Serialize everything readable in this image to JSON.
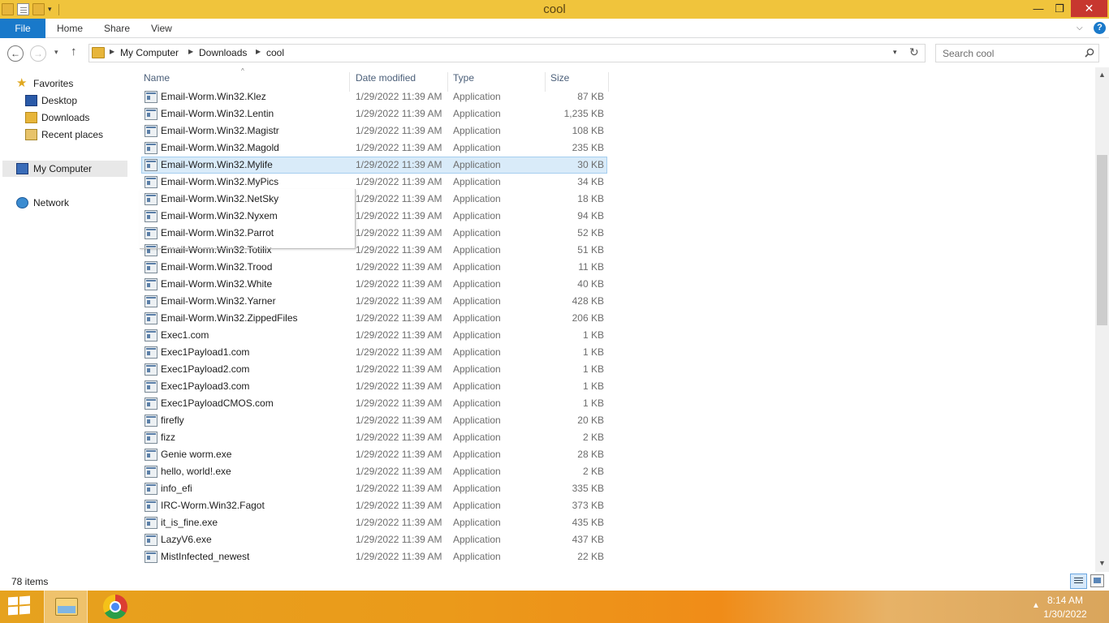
{
  "window": {
    "title": "cool",
    "minimize": "—",
    "maximize": "❐",
    "close": "✕"
  },
  "ribbon": {
    "file": "File",
    "home": "Home",
    "share": "Share",
    "view": "View",
    "expand": "⌵",
    "help": "?"
  },
  "nav": {
    "back": "←",
    "forward": "→",
    "recent": "▾",
    "up": "↑"
  },
  "address": {
    "breadcrumb": [
      "My Computer",
      "Downloads",
      "cool"
    ],
    "separator": "▶",
    "dropdown": "▾",
    "refresh": "↻"
  },
  "search": {
    "placeholder": "Search cool"
  },
  "navpane": {
    "favorites": "Favorites",
    "desktop": "Desktop",
    "downloads": "Downloads",
    "recent_places": "Recent places",
    "my_computer": "My Computer",
    "network": "Network"
  },
  "columns": {
    "name": "Name",
    "date": "Date modified",
    "type": "Type",
    "size": "Size",
    "sort_indicator": "^"
  },
  "files": [
    {
      "name": "Email-Worm.Win32.Klez",
      "date": "1/29/2022 11:39 AM",
      "type": "Application",
      "size": "87 KB",
      "icon": "application-icon"
    },
    {
      "name": "Email-Worm.Win32.Lentin",
      "date": "1/29/2022 11:39 AM",
      "type": "Application",
      "size": "1,235 KB",
      "icon": "smiley-icon"
    },
    {
      "name": "Email-Worm.Win32.Magistr",
      "date": "1/29/2022 11:39 AM",
      "type": "Application",
      "size": "108 KB",
      "icon": "document-icon"
    },
    {
      "name": "Email-Worm.Win32.Magold",
      "date": "1/29/2022 11:39 AM",
      "type": "Application",
      "size": "235 KB",
      "icon": "picture-icon"
    },
    {
      "name": "Email-Worm.Win32.Mylife",
      "date": "1/29/2022 11:39 AM",
      "type": "Application",
      "size": "30 KB",
      "icon": "green-man-icon",
      "selected": true
    },
    {
      "name": "Email-Worm.Win32.MyPics",
      "date": "1/29/2022 11:39 AM",
      "type": "Application",
      "size": "34 KB",
      "icon": "shortcut-icon"
    },
    {
      "name": "Email-Worm.Win32.NetSky",
      "date": "1/29/2022 11:39 AM",
      "type": "Application",
      "size": "18 KB",
      "icon": "application-icon"
    },
    {
      "name": "Email-Worm.Win32.Nyxem",
      "date": "1/29/2022 11:39 AM",
      "type": "Application",
      "size": "94 KB",
      "icon": "computer-icon"
    },
    {
      "name": "Email-Worm.Win32.Parrot",
      "date": "1/29/2022 11:39 AM",
      "type": "Application",
      "size": "52 KB",
      "icon": "parrot-icon"
    },
    {
      "name": "Email-Worm.Win32.Totilix",
      "date": "1/29/2022 11:39 AM",
      "type": "Application",
      "size": "51 KB",
      "icon": "application-icon"
    },
    {
      "name": "Email-Worm.Win32.Trood",
      "date": "1/29/2022 11:39 AM",
      "type": "Application",
      "size": "11 KB",
      "icon": "computer-icon"
    },
    {
      "name": "Email-Worm.Win32.White",
      "date": "1/29/2022 11:39 AM",
      "type": "Application",
      "size": "40 KB",
      "icon": "monitor-icon"
    },
    {
      "name": "Email-Worm.Win32.Yarner",
      "date": "1/29/2022 11:39 AM",
      "type": "Application",
      "size": "428 KB",
      "icon": "computer-icon"
    },
    {
      "name": "Email-Worm.Win32.ZippedFiles",
      "date": "1/29/2022 11:39 AM",
      "type": "Application",
      "size": "206 KB",
      "icon": "archive-icon"
    },
    {
      "name": "Exec1.com",
      "date": "1/29/2022 11:39 AM",
      "type": "Application",
      "size": "1 KB",
      "icon": "application-icon"
    },
    {
      "name": "Exec1Payload1.com",
      "date": "1/29/2022 11:39 AM",
      "type": "Application",
      "size": "1 KB",
      "icon": "application-icon"
    },
    {
      "name": "Exec1Payload2.com",
      "date": "1/29/2022 11:39 AM",
      "type": "Application",
      "size": "1 KB",
      "icon": "application-icon"
    },
    {
      "name": "Exec1Payload3.com",
      "date": "1/29/2022 11:39 AM",
      "type": "Application",
      "size": "1 KB",
      "icon": "application-icon"
    },
    {
      "name": "Exec1PayloadCMOS.com",
      "date": "1/29/2022 11:39 AM",
      "type": "Application",
      "size": "1 KB",
      "icon": "application-icon"
    },
    {
      "name": "firefly",
      "date": "1/29/2022 11:39 AM",
      "type": "Application",
      "size": "20 KB",
      "icon": "application-icon"
    },
    {
      "name": "fizz",
      "date": "1/29/2022 11:39 AM",
      "type": "Application",
      "size": "2 KB",
      "icon": "application-icon"
    },
    {
      "name": "Genie worm.exe",
      "date": "1/29/2022 11:39 AM",
      "type": "Application",
      "size": "28 KB",
      "icon": "smiley-icon"
    },
    {
      "name": "hello, world!.exe",
      "date": "1/29/2022 11:39 AM",
      "type": "Application",
      "size": "2 KB",
      "icon": "application-icon"
    },
    {
      "name": "info_efi",
      "date": "1/29/2022 11:39 AM",
      "type": "Application",
      "size": "335 KB",
      "icon": "application-icon"
    },
    {
      "name": "IRC-Worm.Win32.Fagot",
      "date": "1/29/2022 11:39 AM",
      "type": "Application",
      "size": "373 KB",
      "icon": "application-icon"
    },
    {
      "name": "it_is_fine.exe",
      "date": "1/29/2022 11:39 AM",
      "type": "Application",
      "size": "435 KB",
      "icon": "application-icon"
    },
    {
      "name": "LazyV6.exe",
      "date": "1/29/2022 11:39 AM",
      "type": "Application",
      "size": "437 KB",
      "icon": "application-icon"
    },
    {
      "name": "MistInfected_newest",
      "date": "1/29/2022 11:39 AM",
      "type": "Application",
      "size": "22 KB",
      "icon": "application-icon"
    }
  ],
  "status": {
    "item_count": "78 items"
  },
  "scrollbar": {
    "up": "▲",
    "down": "▼"
  },
  "taskbar": {
    "tray_arrow": "▲",
    "time": "8:14 AM",
    "date": "1/30/2022"
  },
  "colors": {
    "titlebar": "#f0c43c",
    "file_tab": "#1979ca",
    "selection": "#d9ebf9",
    "taskbar": "#eb9a1a"
  }
}
